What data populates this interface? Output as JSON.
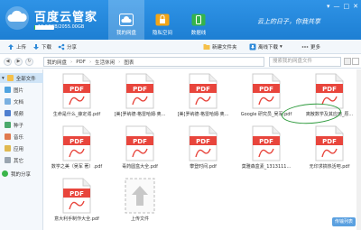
{
  "app": {
    "title": "百度云管家",
    "quota_text": "19.57GB/2055.00GB",
    "quota_fraction": 0.0095,
    "slogan": "云上的日子，你我共享",
    "window_controls": [
      "▾",
      "—",
      "□",
      "✕"
    ]
  },
  "nav_tabs": [
    {
      "label": "我的网盘",
      "icon": "cloud-icon",
      "active": true
    },
    {
      "label": "隐私空间",
      "icon": "lock-icon",
      "active": false
    },
    {
      "label": "数据线",
      "icon": "phone-icon",
      "active": false
    }
  ],
  "toolbar": {
    "upload": "上传",
    "download": "下载",
    "share": "分享",
    "new_folder": "新建文件夹",
    "offline_download": "离线下载",
    "more": "更多"
  },
  "address": {
    "crumbs": [
      "我的网盘",
      "PDF",
      "生活休闲",
      "图表"
    ],
    "search_placeholder": "搜索我的网盘文件"
  },
  "sidebar": {
    "all_files": "全部文件",
    "categories": [
      "图片",
      "文档",
      "视频",
      "种子",
      "音乐",
      "应用",
      "其它"
    ],
    "my_share": "我的分享"
  },
  "files": [
    {
      "name": "生命是什么_薛定谔.pdf",
      "type": "pdf"
    },
    {
      "name": "[美]罗纳德·格雷哈姆·奥...",
      "type": "pdf"
    },
    {
      "name": "[美]罗纳德·格雷哈姆·奥...",
      "type": "pdf"
    },
    {
      "name": "Google 研究员_吴军.pdf",
      "type": "pdf"
    },
    {
      "name": "离散数学及其应用_原...",
      "type": "pdf"
    },
    {
      "name": "数学之美（吴军 著）.pdf",
      "type": "pdf"
    },
    {
      "name": "毒药圆盒大全.pdf",
      "type": "pdf"
    },
    {
      "name": "攀登时间.pdf",
      "type": "pdf"
    },
    {
      "name": "莫雅森盒素_1313111...",
      "type": "pdf"
    },
    {
      "name": "无印求搞热活吧.pdf",
      "type": "pdf"
    },
    {
      "name": "意大利手制作大全.pdf",
      "type": "pdf"
    },
    {
      "name": "上传文件",
      "type": "upload"
    }
  ],
  "fab_label": "传输列表",
  "colors": {
    "brand_blue": "#1d7fd3",
    "pdf_red": "#e8453c",
    "annotation_green": "#2d9a3c",
    "sidebar_bg": "#f4f8fc"
  }
}
